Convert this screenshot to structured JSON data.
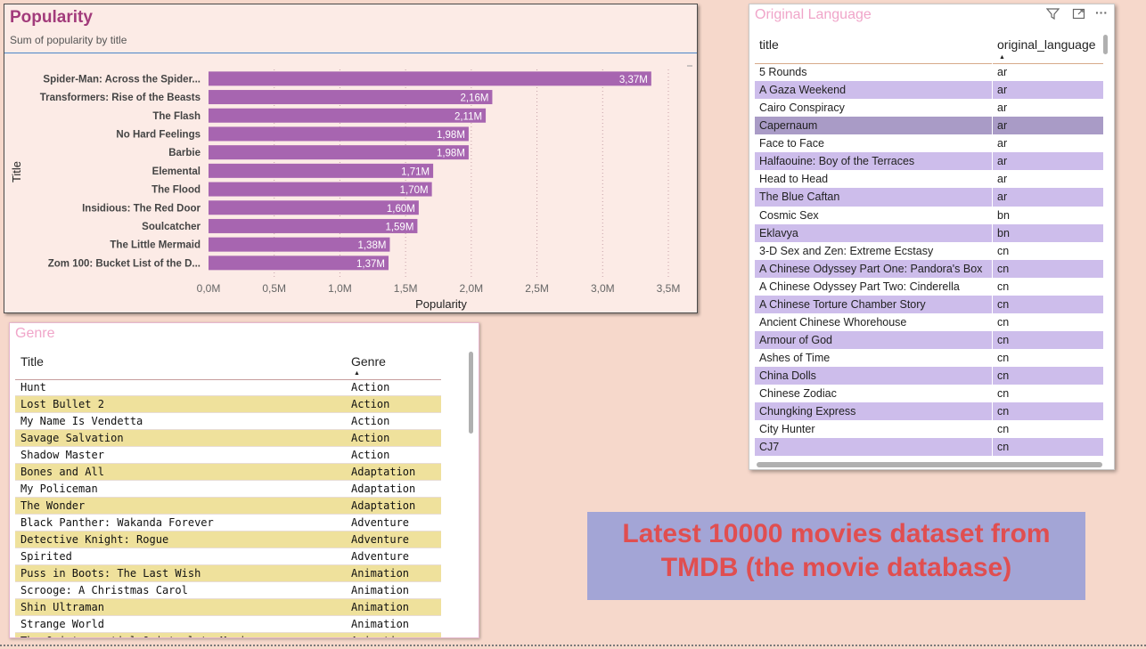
{
  "popularity": {
    "title": "Popularity",
    "subtitle": "Sum of popularity by title",
    "chart_data": {
      "type": "bar",
      "orientation": "horizontal",
      "categories": [
        "Spider-Man: Across the Spider...",
        "Transformers: Rise of the Beasts",
        "The Flash",
        "No Hard Feelings",
        "Barbie",
        "Elemental",
        "The Flood",
        "Insidious: The Red Door",
        "Soulcatcher",
        "The Little Mermaid",
        "Zom 100: Bucket List of the D..."
      ],
      "values": [
        3370000,
        2160000,
        2110000,
        1980000,
        1980000,
        1710000,
        1700000,
        1600000,
        1590000,
        1380000,
        1370000
      ],
      "data_labels": [
        "3,37M",
        "2,16M",
        "2,11M",
        "1,98M",
        "1,98M",
        "1,71M",
        "1,70M",
        "1,60M",
        "1,59M",
        "1,38M",
        "1,37M"
      ],
      "xlabel": "Popularity",
      "ylabel": "Title",
      "xlim": [
        0,
        3500000
      ],
      "ticks": [
        0,
        500000,
        1000000,
        1500000,
        2000000,
        2500000,
        3000000,
        3500000
      ],
      "tick_labels": [
        "0,0M",
        "0,5M",
        "1,0M",
        "1,5M",
        "2,0M",
        "2,5M",
        "3,0M",
        "3,5M"
      ],
      "grid": "vertical dotted",
      "bar_color": "#a765b0"
    }
  },
  "genre": {
    "title": "Genre",
    "columns": [
      "Title",
      "Genre"
    ],
    "rows": [
      [
        "Hunt",
        "Action"
      ],
      [
        "Lost Bullet 2",
        "Action"
      ],
      [
        "My Name Is Vendetta",
        "Action"
      ],
      [
        "Savage Salvation",
        "Action"
      ],
      [
        "Shadow Master",
        "Action"
      ],
      [
        "Bones and All",
        "Adaptation"
      ],
      [
        "My Policeman",
        "Adaptation"
      ],
      [
        "The Wonder",
        "Adaptation"
      ],
      [
        "Black Panther: Wakanda Forever",
        "Adventure"
      ],
      [
        "Detective Knight: Rogue",
        "Adventure"
      ],
      [
        "Spirited",
        "Adventure"
      ],
      [
        "Puss in Boots: The Last Wish",
        "Animation"
      ],
      [
        "Scrooge: A Christmas Carol",
        "Animation"
      ],
      [
        "Shin Ultraman",
        "Animation"
      ],
      [
        "Strange World",
        "Animation"
      ],
      [
        "The Quintessential Quintuplets Movie",
        "Animation"
      ]
    ]
  },
  "language": {
    "title": "Original Language",
    "columns": [
      "title",
      "original_language"
    ],
    "icons": [
      "filter-icon",
      "focus-mode-icon",
      "more-options-icon"
    ],
    "selected_row": 3,
    "rows": [
      [
        "5 Rounds",
        "ar"
      ],
      [
        "A Gaza Weekend",
        "ar"
      ],
      [
        "Cairo Conspiracy",
        "ar"
      ],
      [
        "Capernaum",
        "ar"
      ],
      [
        "Face to Face",
        "ar"
      ],
      [
        "Halfaouine: Boy of the Terraces",
        "ar"
      ],
      [
        "Head to Head",
        "ar"
      ],
      [
        "The Blue Caftan",
        "ar"
      ],
      [
        "Cosmic Sex",
        "bn"
      ],
      [
        "Eklavya",
        "bn"
      ],
      [
        "3-D Sex and Zen: Extreme Ecstasy",
        "cn"
      ],
      [
        "A Chinese Odyssey Part One: Pandora's Box",
        "cn"
      ],
      [
        "A Chinese Odyssey Part Two: Cinderella",
        "cn"
      ],
      [
        "A Chinese Torture Chamber Story",
        "cn"
      ],
      [
        "Ancient Chinese Whorehouse",
        "cn"
      ],
      [
        "Armour of God",
        "cn"
      ],
      [
        "Ashes of Time",
        "cn"
      ],
      [
        "China Dolls",
        "cn"
      ],
      [
        "Chinese Zodiac",
        "cn"
      ],
      [
        "Chungking Express",
        "cn"
      ],
      [
        "City Hunter",
        "cn"
      ],
      [
        "CJ7",
        "cn"
      ]
    ]
  },
  "banner": {
    "line1": "Latest 10000 movies dataset from",
    "line2": "TMDB (the movie database)"
  }
}
